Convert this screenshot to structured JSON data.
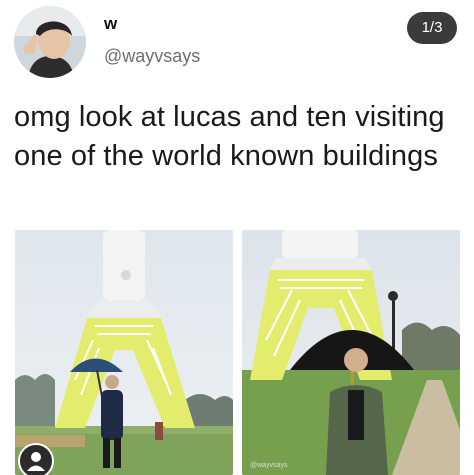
{
  "post": {
    "display_name": "w",
    "handle": "@wayvsays",
    "text": "omg look at lucas and ten visiting one of the world known buildings"
  },
  "media": {
    "counter": "1/3",
    "images": [
      {
        "icon": "photo-person-umbrella-blue"
      },
      {
        "icon": "photo-person-umbrella-black"
      }
    ],
    "watermark": "@wayvsays"
  },
  "colors": {
    "counter_bg": "#3b3b3b",
    "text": "#1a1a1a",
    "handle": "#6f6f6f",
    "building_yellow": "#e4ec6e"
  }
}
